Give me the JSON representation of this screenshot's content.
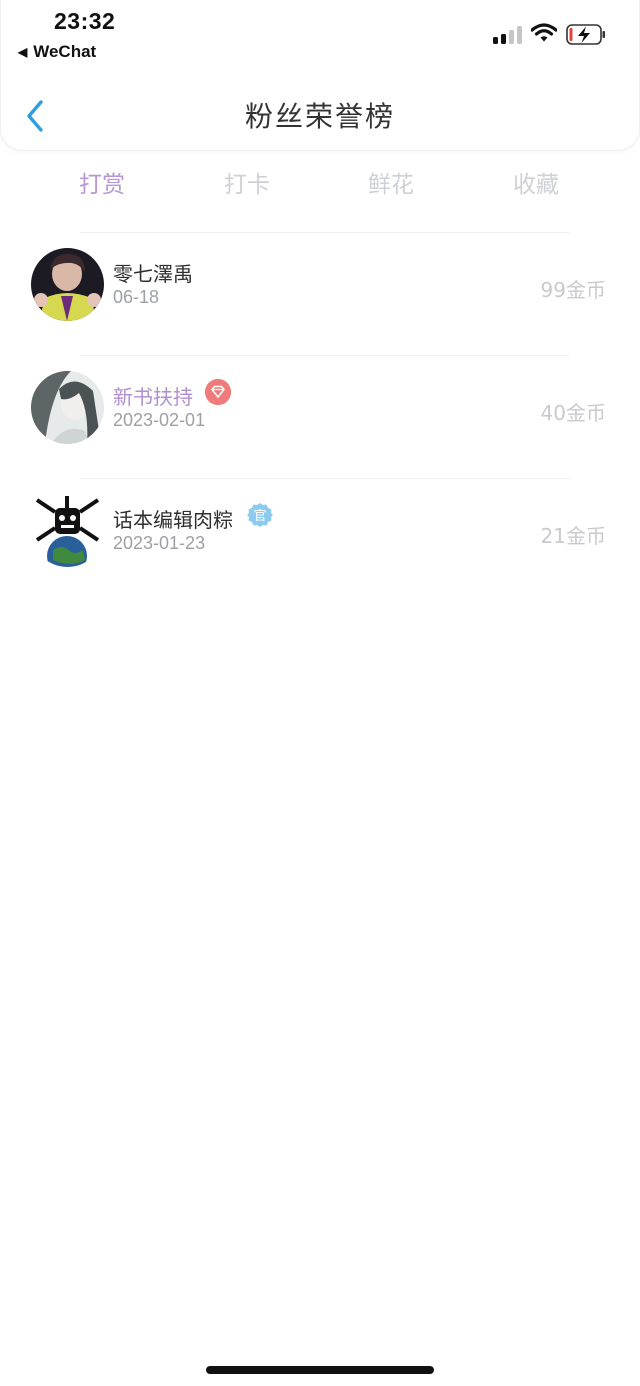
{
  "status_bar": {
    "time": "23:32",
    "back_app": "WeChat"
  },
  "header": {
    "title": "粉丝荣誉榜"
  },
  "tabs": [
    {
      "label": "打赏",
      "active": true
    },
    {
      "label": "打卡",
      "active": false
    },
    {
      "label": "鲜花",
      "active": false
    },
    {
      "label": "收藏",
      "active": false
    }
  ],
  "fans": [
    {
      "name": "零七澤禹",
      "date": "06-18",
      "amount": "99金币",
      "badge": null
    },
    {
      "name": "新书扶持",
      "date": "2023-02-01",
      "amount": "40金币",
      "badge": "diamond-badge"
    },
    {
      "name": "话本编辑肉粽",
      "date": "2023-01-23",
      "amount": "21金币",
      "badge": "官"
    }
  ],
  "colors": {
    "accent_purple": "#b796d6",
    "back_arrow_blue": "#2f9de0",
    "vip_badge_red": "#f07b7b",
    "official_badge_blue": "#8ccaf0"
  }
}
